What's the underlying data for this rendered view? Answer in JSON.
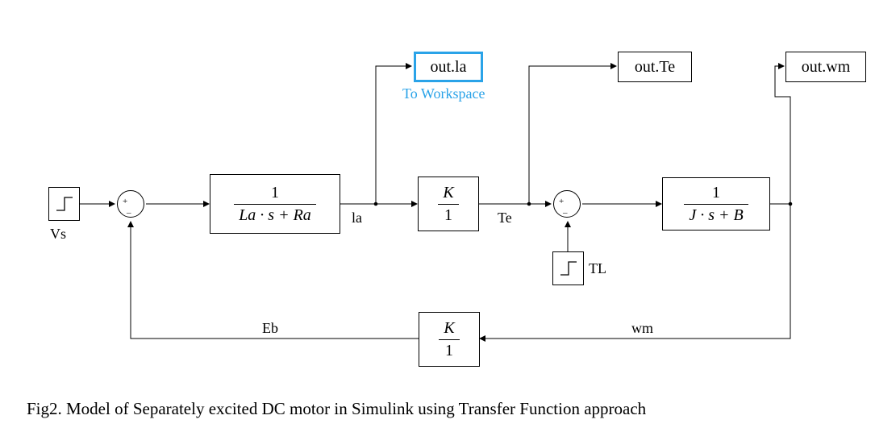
{
  "diagram": {
    "blocks": {
      "vs_step": {
        "label": "Vs"
      },
      "sum1": {
        "plus": "+",
        "minus": "_"
      },
      "tf_elec": {
        "num": "1",
        "den": "La · s + Ra"
      },
      "out_la": {
        "text": "out.la",
        "sublabel": "To Workspace"
      },
      "gain_k1": {
        "num": "K",
        "den": "1"
      },
      "out_te": {
        "text": "out.Te"
      },
      "sum2": {
        "plus": "+",
        "minus": "_"
      },
      "tl_step": {
        "label": "TL"
      },
      "tf_mech": {
        "num": "1",
        "den": "J · s + B"
      },
      "out_wm": {
        "text": "out.wm"
      },
      "gain_k2": {
        "num": "K",
        "den": "1"
      }
    },
    "signals": {
      "la": "la",
      "te": "Te",
      "eb": "Eb",
      "wm": "wm"
    }
  },
  "caption": "Fig2. Model of Separately excited DC motor in Simulink using Transfer Function approach"
}
